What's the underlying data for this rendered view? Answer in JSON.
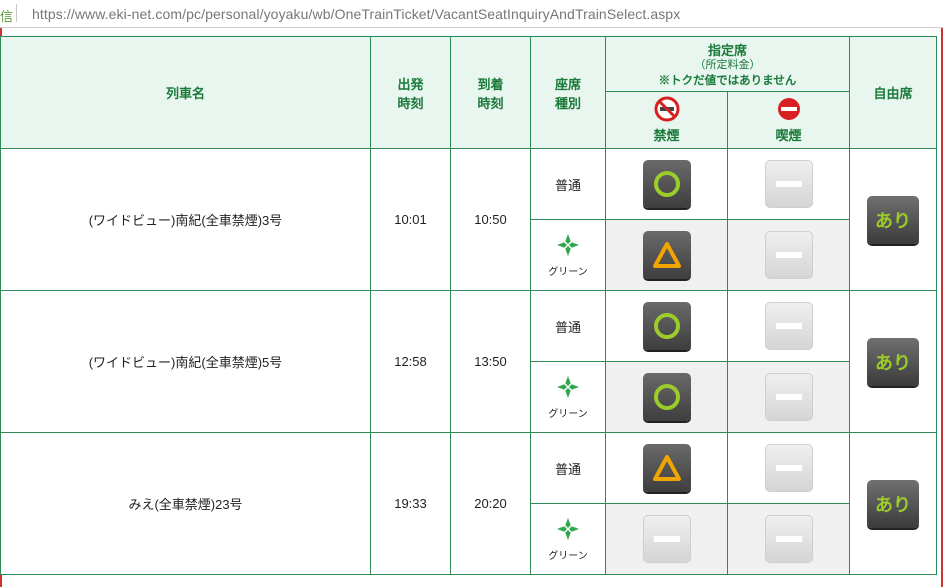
{
  "browser": {
    "lead_char": "信",
    "url": "https://www.eki-net.com/pc/personal/yoyaku/wb/OneTrainTicket/VacantSeatInquiryAndTrainSelect.aspx"
  },
  "header": {
    "train_name": "列車名",
    "dep_1": "出発",
    "dep_2": "時刻",
    "arr_1": "到着",
    "arr_2": "時刻",
    "seat_1": "座席",
    "seat_2": "種別",
    "reserved_title": "指定席",
    "reserved_sub": "（所定料金）",
    "reserved_note": "※トクだ値ではありません",
    "non_smoking": "禁煙",
    "smoking": "喫煙",
    "free_seat": "自由席"
  },
  "seat_types": {
    "ordinary": "普通",
    "green": "グリーン"
  },
  "trains": [
    {
      "name": "(ワイドビュー)南紀(全車禁煙)3号",
      "dep": "10:01",
      "arr": "10:50",
      "ordinary_ns": "circle",
      "ordinary_s": "dash",
      "green_ns": "triangle",
      "green_s": "dash",
      "free": "あり"
    },
    {
      "name": "(ワイドビュー)南紀(全車禁煙)5号",
      "dep": "12:58",
      "arr": "13:50",
      "ordinary_ns": "circle",
      "ordinary_s": "dash",
      "green_ns": "circle",
      "green_s": "dash",
      "free": "あり"
    },
    {
      "name": "みえ(全車禁煙)23号",
      "dep": "19:33",
      "arr": "20:20",
      "ordinary_ns": "triangle",
      "ordinary_s": "dash",
      "green_ns": "dash",
      "green_s": "dash",
      "free": "あり"
    }
  ],
  "colors": {
    "border_green": "#2e8b57",
    "header_bg": "#e8f6ef",
    "header_text": "#1a7a3a",
    "circle": "#9ccc29",
    "triangle": "#f0a500"
  }
}
